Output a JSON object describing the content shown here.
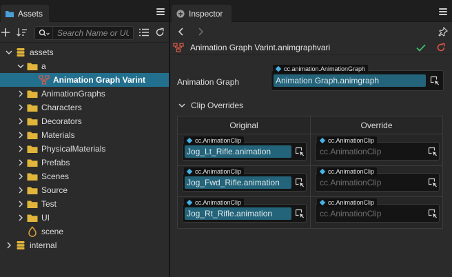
{
  "assets_panel": {
    "tab_label": "Assets",
    "search_placeholder": "Search Name or UUID",
    "tree": [
      {
        "label": "assets",
        "depth": 0,
        "expanded": true,
        "icon": "db-icon",
        "selected": false
      },
      {
        "label": "a",
        "depth": 1,
        "expanded": true,
        "icon": "folder-icon",
        "selected": false
      },
      {
        "label": "Animation Graph Varint",
        "depth": 2,
        "expanded": null,
        "icon": "anim-graph-variant-icon",
        "selected": true
      },
      {
        "label": "AnimationGraphs",
        "depth": 1,
        "expanded": false,
        "icon": "folder-icon",
        "selected": false
      },
      {
        "label": "Characters",
        "depth": 1,
        "expanded": false,
        "icon": "folder-icon",
        "selected": false
      },
      {
        "label": "Decorators",
        "depth": 1,
        "expanded": false,
        "icon": "folder-icon",
        "selected": false
      },
      {
        "label": "Materials",
        "depth": 1,
        "expanded": false,
        "icon": "folder-icon",
        "selected": false
      },
      {
        "label": "PhysicalMaterials",
        "depth": 1,
        "expanded": false,
        "icon": "folder-icon",
        "selected": false
      },
      {
        "label": "Prefabs",
        "depth": 1,
        "expanded": false,
        "icon": "folder-icon",
        "selected": false
      },
      {
        "label": "Scenes",
        "depth": 1,
        "expanded": false,
        "icon": "folder-icon",
        "selected": false
      },
      {
        "label": "Source",
        "depth": 1,
        "expanded": false,
        "icon": "folder-icon",
        "selected": false
      },
      {
        "label": "Test",
        "depth": 1,
        "expanded": false,
        "icon": "folder-icon",
        "selected": false
      },
      {
        "label": "UI",
        "depth": 1,
        "expanded": false,
        "icon": "folder-icon",
        "selected": false
      },
      {
        "label": "scene",
        "depth": 1,
        "expanded": null,
        "icon": "scene-icon",
        "selected": false
      },
      {
        "label": "internal",
        "depth": 0,
        "expanded": false,
        "icon": "db-icon",
        "selected": false
      }
    ]
  },
  "inspector": {
    "tab_label": "Inspector",
    "file_name": "Animation Graph Varint.animgraphvari",
    "animation_graph": {
      "label": "Animation Graph",
      "type": "cc.animation.AnimationGraph",
      "value": "Animation Graph.animgraph"
    },
    "clip_overrides": {
      "label": "Clip Overrides",
      "col_original": "Original",
      "col_override": "Override",
      "rows": [
        {
          "original_type": "cc.AnimationClip",
          "original_value": "Jog_Lt_Rifle.animation",
          "override_type": "cc.AnimationClip",
          "override_value": "cc.AnimationClip"
        },
        {
          "original_type": "cc.AnimationClip",
          "original_value": "Jog_Fwd_Rifle.animation",
          "override_type": "cc.AnimationClip",
          "override_value": "cc.AnimationClip"
        },
        {
          "original_type": "cc.AnimationClip",
          "original_value": "Jog_Rt_Rifle.animation",
          "override_type": "cc.AnimationClip",
          "override_value": "cc.AnimationClip"
        }
      ]
    }
  },
  "colors": {
    "selection": "#22708e",
    "asset_fill": "#23647a",
    "asset_diamond": "#49b0e6",
    "apply_check": "#3fbf6a",
    "revert": "#e0524a",
    "folder": "#e1b53a"
  }
}
